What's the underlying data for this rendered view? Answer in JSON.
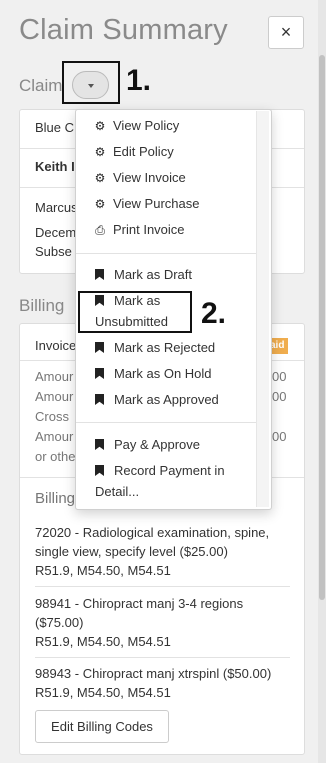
{
  "header": {
    "title": "Claim Summary",
    "close_label": "×"
  },
  "claim_section": {
    "heading": "Claim",
    "card": {
      "line1": "Blue C",
      "patient": "Keith I",
      "line3": "Marcus",
      "line4": "Decem",
      "line5": "Subse"
    }
  },
  "billing_section": {
    "heading": "Billing",
    "invoice_label": "Invoice",
    "badge": "aid",
    "rows": [
      {
        "label": "Amour",
        "value": "00"
      },
      {
        "label": "Amour",
        "value": "00"
      },
      {
        "label": "Cross",
        "value": ""
      },
      {
        "label": "Amour",
        "value": "00"
      },
      {
        "label": "or othe",
        "value": ""
      }
    ],
    "codes_heading": "Billing",
    "codes": [
      {
        "line1": "72020 - Radiological examination, spine,",
        "line2": "single view, specify level ($25.00)",
        "line3": "R51.9, M54.50, M54.51"
      },
      {
        "line1": "98941 - Chiropract manj 3-4 regions",
        "line2": "($75.00)",
        "line3": "R51.9, M54.50, M54.51"
      },
      {
        "line1": "98943 - Chiropract manj xtrspinl ($50.00)",
        "line2": "R51.9, M54.50, M54.51",
        "line3": ""
      }
    ],
    "edit_button": "Edit Billing Codes"
  },
  "dropdown": {
    "view_policy": "View Policy",
    "edit_policy": "Edit Policy",
    "view_invoice": "View Invoice",
    "view_purchase": "View Purchase",
    "print_invoice": "Print Invoice",
    "mark_draft": "Mark as Draft",
    "mark_unsubmitted_1": "Mark as",
    "mark_unsubmitted_2": "Unsubmitted",
    "mark_rejected": "Mark as Rejected",
    "mark_on_hold": "Mark as On Hold",
    "mark_approved": "Mark as Approved",
    "pay_approve": "Pay & Approve",
    "record_payment_1": "Record Payment in",
    "record_payment_2": "Detail..."
  },
  "annotations": {
    "one": "1.",
    "two": "2."
  }
}
